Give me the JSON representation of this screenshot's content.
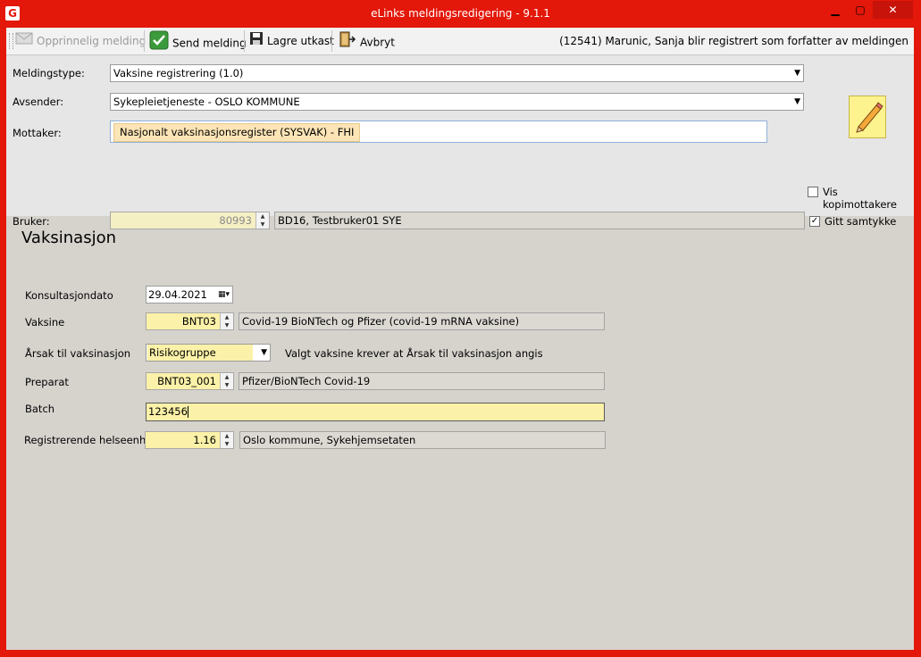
{
  "window": {
    "title": "eLinks meldingsredigering - 9.1.1",
    "app_icon": "G",
    "minimize": "▁",
    "maximize": "▢",
    "close": "✕"
  },
  "toolbar": {
    "original_label": "Opprinnelig melding",
    "send_label": "Send melding",
    "save_label": "Lagre utkast",
    "cancel_label": "Avbryt",
    "author_note": "(12541) Marunic, Sanja blir registrert som forfatter av meldingen"
  },
  "header_form": {
    "message_type_label": "Meldingstype:",
    "message_type_value": "Vaksine registrering (1.0)",
    "sender_label": "Avsender:",
    "sender_value": "Sykepleietjeneste - OSLO KOMMUNE",
    "recipient_label": "Mottaker:",
    "recipient_value": "Nasjonalt vaksinasjonsregister (SYSVAK) - FHI",
    "show_copy_label": "Vis kopimottakere",
    "show_copy_checked": false,
    "user_label": "Bruker:",
    "user_id": "80993",
    "user_name": "BD16, Testbruker01 SYE",
    "consent_label": "Gitt samtykke",
    "consent_checked": true
  },
  "vaccination": {
    "title": "Vaksinasjon",
    "date_label": "Konsultasjondato",
    "date_value": "29.04.2021",
    "vaccine_label": "Vaksine",
    "vaccine_code": "BNT03",
    "vaccine_name": "Covid-19 BioNTech og Pfizer (covid-19 mRNA vaksine)",
    "reason_label": "Årsak til vaksinasjon",
    "reason_value": "Risikogruppe",
    "reason_note": "Valgt vaksine krever at Årsak til vaksinasjon angis",
    "preparation_label": "Preparat",
    "preparation_code": "BNT03_001",
    "preparation_name": "Pfizer/BioNTech Covid-19",
    "batch_label": "Batch",
    "batch_value": "123456",
    "health_unit_label": "Registrerende helseenhet:",
    "health_unit_code": "1.16",
    "health_unit_name": "Oslo kommune, Sykehjemsetaten"
  },
  "colors": {
    "titlebar": "#e3170a",
    "input_yellow": "#fbf1a8",
    "chip": "#fce4b6",
    "panel": "#d6d3cd"
  }
}
